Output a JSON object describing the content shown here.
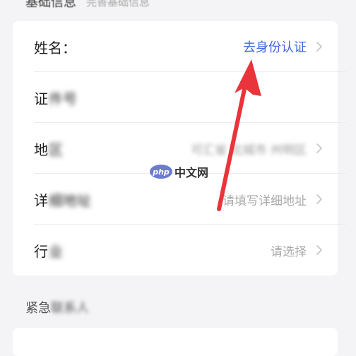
{
  "section_basic": {
    "title": "基础信息",
    "subtitle": "完善基础信息"
  },
  "rows": [
    {
      "label_clear": "姓名：",
      "label_rest": "",
      "value": "去身份认证",
      "value_style": "link"
    },
    {
      "label_clear": "证",
      "label_rest": "件号",
      "value": "",
      "value_style": "none"
    },
    {
      "label_clear": "地",
      "label_rest": "区",
      "value": "可汇省 北城市 州明区",
      "value_style": "blurred"
    },
    {
      "label_clear": "详",
      "label_rest": "细地址",
      "value": "请填写详细地址",
      "value_style": "placeholder"
    },
    {
      "label_clear": "行",
      "label_rest": "业",
      "value": "请选择",
      "value_style": "placeholder"
    }
  ],
  "section_emergency": {
    "title_clear": "紧急",
    "title_rest": "联系人"
  },
  "watermark": {
    "logo_text": "php",
    "site_text": "中文网"
  },
  "colors": {
    "link": "#3f66e0",
    "arrow": "#e8343a",
    "placeholder": "#a9a9a9"
  },
  "icons": {
    "row_chevron": "chevron-right-icon",
    "annotation": "red-arrow-pointer"
  }
}
